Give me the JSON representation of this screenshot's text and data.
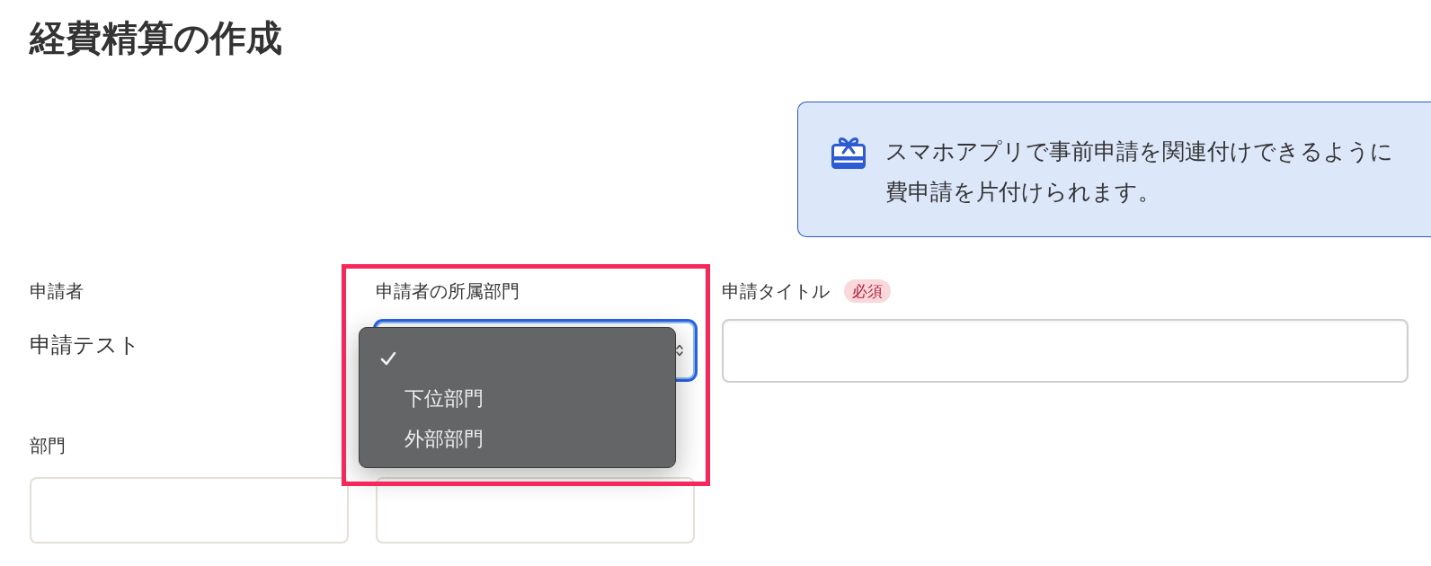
{
  "page_title": "経費精算の作成",
  "notice": {
    "lines": [
      "スマホアプリで事前申請を関連付けできるように",
      "費申請を片付けられます。"
    ]
  },
  "form": {
    "applicant": {
      "label": "申請者",
      "value": "申請テスト"
    },
    "applicant_department": {
      "label": "申請者の所属部門",
      "focused": true,
      "expanded": true,
      "options": [
        {
          "selected": true
        },
        {
          "label": "下位部門",
          "selected": false
        },
        {
          "label": "外部部門",
          "selected": false
        }
      ]
    },
    "request_title": {
      "label": "申請タイトル",
      "required_badge": "必須"
    },
    "department": {
      "label": "部門"
    }
  }
}
